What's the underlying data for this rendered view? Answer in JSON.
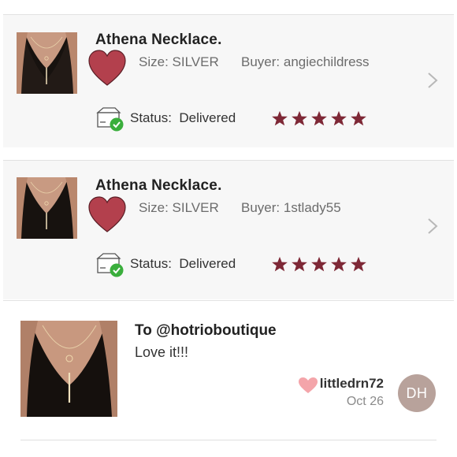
{
  "orders": [
    {
      "title": "Athena Necklace.",
      "size_label": "Size:",
      "size_value": "SILVER",
      "buyer_label": "Buyer:",
      "buyer_value": "angiechildress",
      "status_label": "Status:",
      "status_value": "Delivered",
      "rating": 5
    },
    {
      "title": "Athena Necklace.",
      "size_label": "Size:",
      "size_value": "SILVER",
      "buyer_label": "Buyer:",
      "buyer_value": "1stlady55",
      "status_label": "Status:",
      "status_value": "Delivered",
      "rating": 5
    }
  ],
  "review": {
    "to": "To @hotrioboutique",
    "message": "Love it!!!",
    "username": "littledrn72",
    "date": "Oct 26",
    "avatar_initials": "DH"
  },
  "colors": {
    "heart": "#b3404d",
    "star": "#7e2836",
    "check": "#3aae3c",
    "like_heart": "#f4a5aa",
    "avatar": "#b8a29b"
  },
  "icons": {
    "favorite": "heart-icon",
    "status": "package-delivered-icon",
    "rating": "star-icon",
    "navigate": "chevron-right-icon",
    "like": "like-heart-icon"
  }
}
